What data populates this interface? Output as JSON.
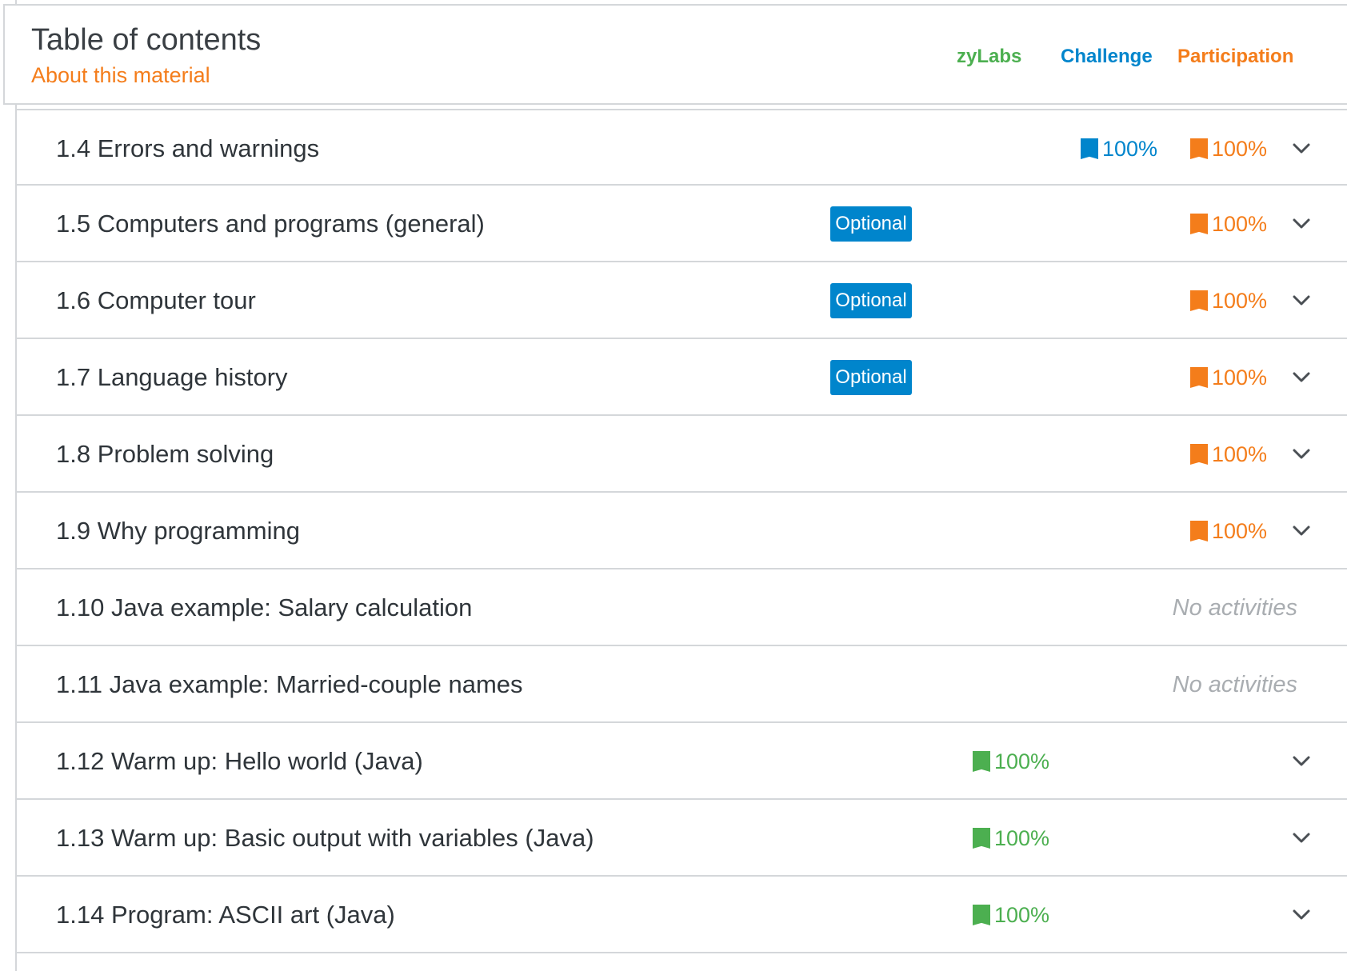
{
  "header": {
    "title": "Table of contents",
    "about_link": "About this material",
    "columns": {
      "zylabs": "zyLabs",
      "challenge": "Challenge",
      "participation": "Participation"
    }
  },
  "colors": {
    "zylabs": "#4caf50",
    "challenge": "#0085cc",
    "participation": "#f47d1b",
    "optional_badge": "#0085cc"
  },
  "sections": [
    {
      "title": "1.4 Errors and warnings",
      "optional": "",
      "zylabs": "",
      "challenge": "100%",
      "participation": "100%",
      "no_activities": "",
      "expand_icon": "chevron-down-icon"
    },
    {
      "title": "1.5 Computers and programs (general)",
      "optional": "Optional",
      "zylabs": "",
      "challenge": "",
      "participation": "100%",
      "no_activities": "",
      "expand_icon": "chevron-down-icon"
    },
    {
      "title": "1.6 Computer tour",
      "optional": "Optional",
      "zylabs": "",
      "challenge": "",
      "participation": "100%",
      "no_activities": "",
      "expand_icon": "chevron-down-icon"
    },
    {
      "title": "1.7 Language history",
      "optional": "Optional",
      "zylabs": "",
      "challenge": "",
      "participation": "100%",
      "no_activities": "",
      "expand_icon": "chevron-down-icon"
    },
    {
      "title": "1.8 Problem solving",
      "optional": "",
      "zylabs": "",
      "challenge": "",
      "participation": "100%",
      "no_activities": "",
      "expand_icon": "chevron-down-icon"
    },
    {
      "title": "1.9 Why programming",
      "optional": "",
      "zylabs": "",
      "challenge": "",
      "participation": "100%",
      "no_activities": "",
      "expand_icon": "chevron-down-icon"
    },
    {
      "title": "1.10 Java example: Salary calculation",
      "optional": "",
      "zylabs": "",
      "challenge": "",
      "participation": "",
      "no_activities": "No activities",
      "expand_icon": ""
    },
    {
      "title": "1.11 Java example: Married-couple names",
      "optional": "",
      "zylabs": "",
      "challenge": "",
      "participation": "",
      "no_activities": "No activities",
      "expand_icon": ""
    },
    {
      "title": "1.12 Warm up: Hello world (Java)",
      "optional": "",
      "zylabs": "100%",
      "challenge": "",
      "participation": "",
      "no_activities": "",
      "expand_icon": "chevron-down-icon"
    },
    {
      "title": "1.13 Warm up: Basic output with variables (Java)",
      "optional": "",
      "zylabs": "100%",
      "challenge": "",
      "participation": "",
      "no_activities": "",
      "expand_icon": "chevron-down-icon"
    },
    {
      "title": "1.14 Program: ASCII art (Java)",
      "optional": "",
      "zylabs": "100%",
      "challenge": "",
      "participation": "",
      "no_activities": "",
      "expand_icon": "chevron-down-icon"
    }
  ]
}
